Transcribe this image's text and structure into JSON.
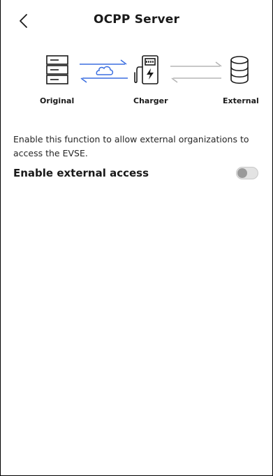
{
  "header": {
    "title": "OCPP Server",
    "back_icon": "chevron-left-icon"
  },
  "diagram": {
    "nodes": [
      {
        "label": "Original",
        "icon": "server-rack-icon"
      },
      {
        "label": "Charger",
        "icon": "charging-station-icon"
      },
      {
        "label": "External",
        "icon": "database-icon"
      }
    ],
    "links": [
      {
        "from": "Original",
        "to": "Charger",
        "icon": "cloud-icon",
        "state": "active",
        "color": "#3b6fe0"
      },
      {
        "from": "Charger",
        "to": "External",
        "state": "inactive",
        "color": "#b5b5b5"
      }
    ]
  },
  "settings": {
    "description": "Enable this function to allow external organizations to access the EVSE.",
    "external_access": {
      "label": "Enable external access",
      "enabled": false
    }
  }
}
